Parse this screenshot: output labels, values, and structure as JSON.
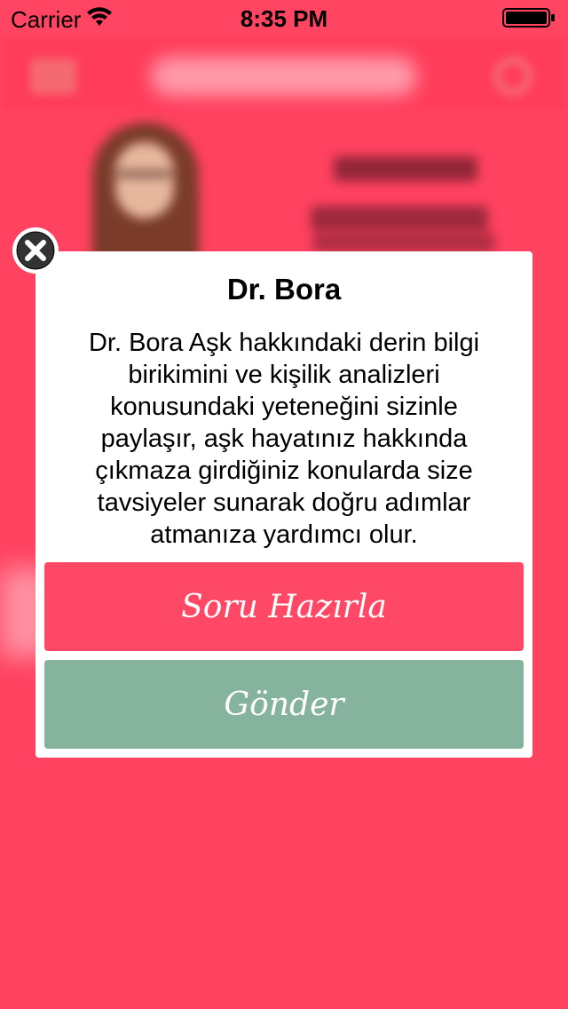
{
  "status_bar": {
    "carrier": "Carrier",
    "time": "8:35 PM",
    "wifi_icon": "wifi-icon",
    "battery_icon": "battery-icon"
  },
  "modal": {
    "title": "Dr. Bora",
    "description": "Dr. Bora Aşk hakkındaki derin bilgi birikimini ve kişilik analizleri konusundaki yeteneğini sizinle paylaşır, aşk hayatınız hakkında çıkmaza girdiğiniz konularda size tavsiyeler sunarak doğru adımlar atmanıza yardımcı olur.",
    "primary_button": "Soru Hazırla",
    "secondary_button": "Gönder",
    "close_icon": "close-icon"
  },
  "background_icons": {
    "menu": "menu-icon",
    "search": "search-icon"
  },
  "colors": {
    "background": "#ff4562",
    "primary_button": "#ff4865",
    "secondary_button": "#86b39d",
    "modal": "#ffffff"
  }
}
